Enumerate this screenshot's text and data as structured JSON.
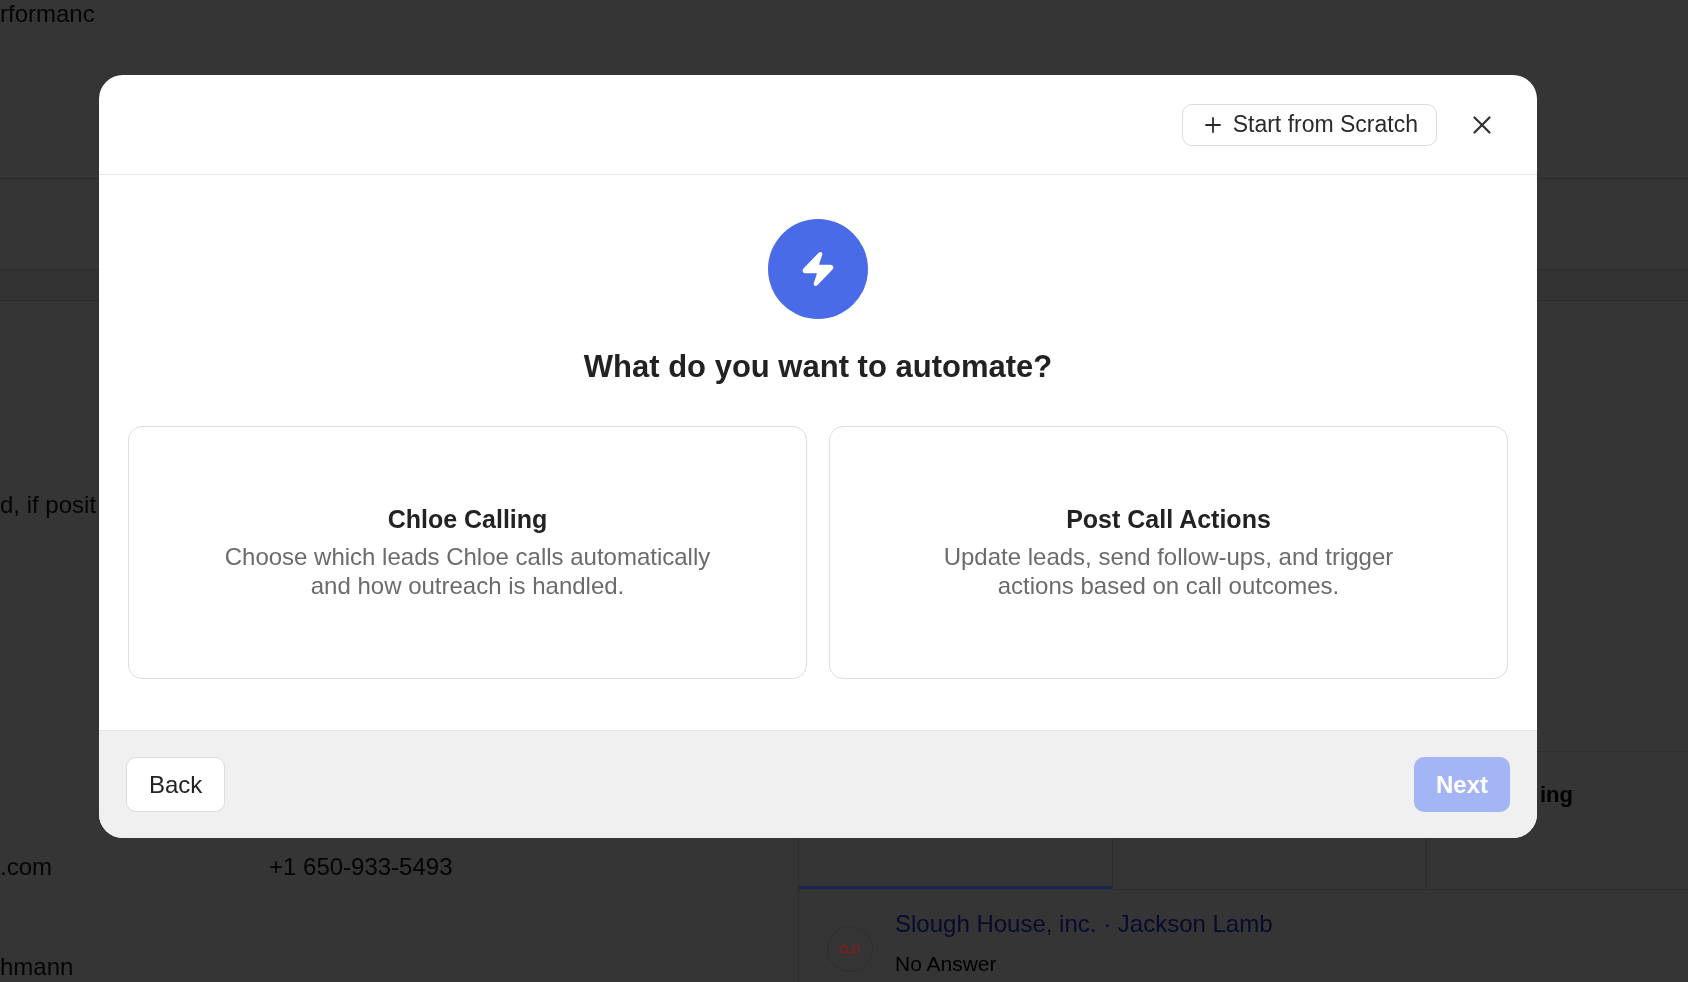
{
  "page": {
    "section_title": "rformanc",
    "description": "d, if posit",
    "email": ".com",
    "phone": "+1 650-933-5493",
    "name": "hmann",
    "stat_label": "ing",
    "call": {
      "title": "Slough House, inc. · Jackson Lamb",
      "status": "No Answer"
    }
  },
  "dialog": {
    "header_button": "Start from Scratch",
    "heading": "What do you want to automate?",
    "options": [
      {
        "title": "Chloe Calling",
        "description": "Choose which leads Chloe calls automatically and how outreach is handled.",
        "selected": false
      },
      {
        "title": "Post Call Actions",
        "description": "Update leads, send follow-ups, and trigger actions based on call outcomes.",
        "selected": false
      }
    ],
    "back": "Back",
    "next": {
      "label": "Next",
      "disabled": true
    }
  }
}
